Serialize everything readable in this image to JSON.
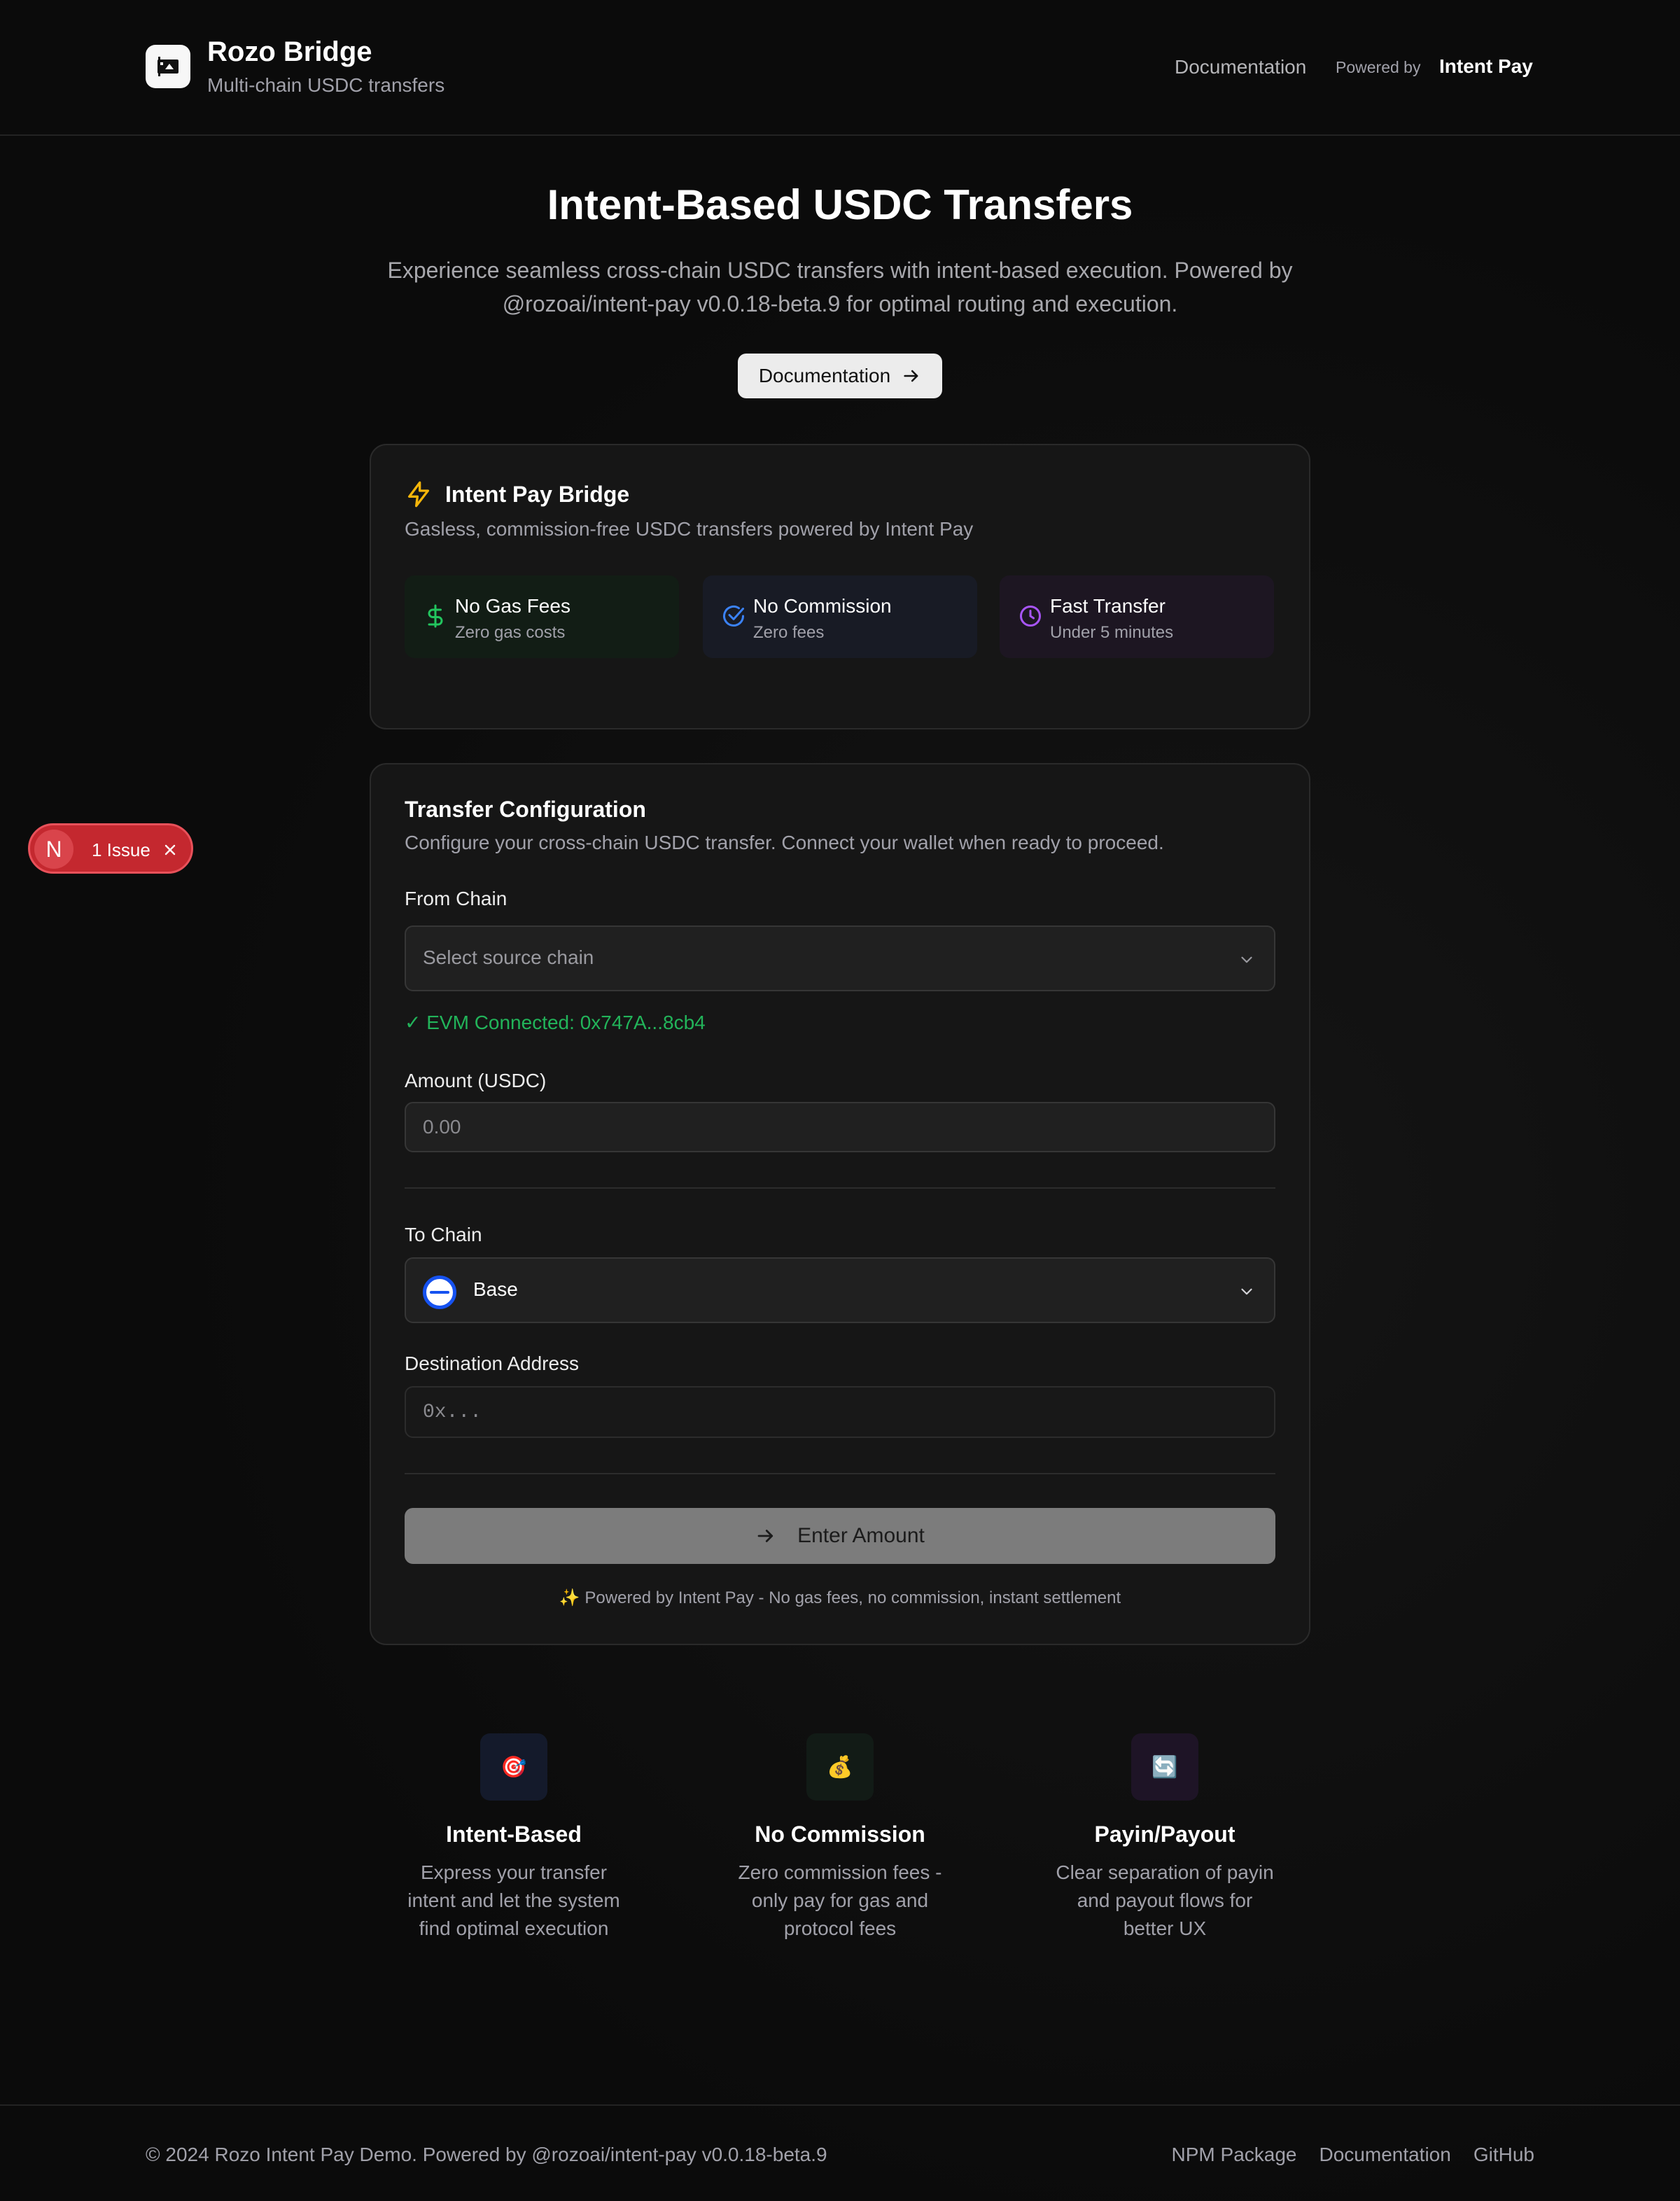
{
  "header": {
    "title": "Rozo Bridge",
    "subtitle": "Multi-chain USDC transfers",
    "nav_documentation": "Documentation",
    "powered_by_label": "Powered by",
    "powered_by_brand": "Intent Pay"
  },
  "hero": {
    "title": "Intent-Based USDC Transfers",
    "description": "Experience seamless cross-chain USDC transfers with intent-based execution. Powered by @rozoai/intent-pay v0.0.18-beta.9 for optimal routing and execution.",
    "button_label": "Documentation"
  },
  "bridge_card": {
    "title": "Intent Pay Bridge",
    "subtitle": "Gasless, commission-free USDC transfers powered by Intent Pay",
    "features": [
      {
        "title": "No Gas Fees",
        "subtitle": "Zero gas costs",
        "icon": "dollar-icon",
        "color": "#22c55e"
      },
      {
        "title": "No Commission",
        "subtitle": "Zero fees",
        "icon": "check-circle-icon",
        "color": "#3b82f6"
      },
      {
        "title": "Fast Transfer",
        "subtitle": "Under 5 minutes",
        "icon": "clock-icon",
        "color": "#a855f7"
      }
    ]
  },
  "transfer": {
    "title": "Transfer Configuration",
    "description": "Configure your cross-chain USDC transfer. Connect your wallet when ready to proceed.",
    "from_chain_label": "From Chain",
    "from_chain_placeholder": "Select source chain",
    "connected_status": "✓ EVM Connected: 0x747A...8cb4",
    "amount_label": "Amount (USDC)",
    "amount_placeholder": "0.00",
    "to_chain_label": "To Chain",
    "to_chain_value": "Base",
    "destination_label": "Destination Address",
    "destination_placeholder": "0x...",
    "submit_label": "Enter Amount",
    "footer_note": "✨ Powered by Intent Pay - No gas fees, no commission, instant settlement"
  },
  "issue_badge": {
    "letter": "N",
    "label": "1 Issue"
  },
  "bottom_features": [
    {
      "icon": "🎯",
      "title": "Intent-Based",
      "description": "Express your transfer intent and let the system find optimal execution"
    },
    {
      "icon": "💰",
      "title": "No Commission",
      "description": "Zero commission fees - only pay for gas and protocol fees"
    },
    {
      "icon": "🔄",
      "title": "Payin/Payout",
      "description": "Clear separation of payin and payout flows for better UX"
    }
  ],
  "footer": {
    "copyright": "© 2024 Rozo Intent Pay Demo. Powered by @rozoai/intent-pay v0.0.18-beta.9",
    "links": [
      "NPM Package",
      "Documentation",
      "GitHub"
    ]
  },
  "colors": {
    "background": "#0b0b0b",
    "card": "#161616",
    "success": "#22b45a",
    "issue": "#c4282f",
    "base_blue": "#1652f0"
  }
}
